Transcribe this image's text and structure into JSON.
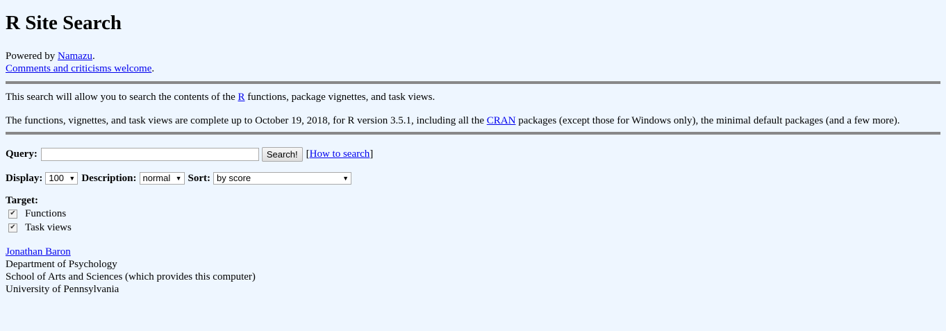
{
  "header": {
    "title": "R Site Search",
    "powered_prefix": "Powered by ",
    "powered_link": "Namazu",
    "powered_suffix": ".",
    "comments_link": "Comments and criticisms welcome",
    "comments_suffix": "."
  },
  "intro": {
    "p1_before": "This search will allow you to search the contents of the ",
    "p1_link": "R",
    "p1_after": " functions, package vignettes, and task views.",
    "p2_before": "The functions, vignettes, and task views are complete up to October 19, 2018, for R version 3.5.1, including all the ",
    "p2_link": "CRAN",
    "p2_after": " packages (except those for Windows only), the minimal default packages (and a few more)."
  },
  "form": {
    "query_label": "Query:",
    "query_value": "",
    "search_button": "Search!",
    "how_to_open": "[",
    "how_to_link": "How to search",
    "how_to_close": "]",
    "display_label": "Display:",
    "display_value": "100",
    "description_label": "Description:",
    "description_value": "normal",
    "sort_label": "Sort:",
    "sort_value": "by score",
    "target_label": "Target:",
    "targets": [
      {
        "label": "Functions",
        "checked": true
      },
      {
        "label": "Task views",
        "checked": true
      }
    ]
  },
  "footer": {
    "author_link": "Jonathan Baron",
    "line1": "Department of Psychology",
    "line2": "School of Arts and Sciences (which provides this computer)",
    "line3": "University of Pennsylvania"
  },
  "colors": {
    "background": "#eef6ff",
    "link": "#0000ee",
    "rule": "#888888"
  }
}
